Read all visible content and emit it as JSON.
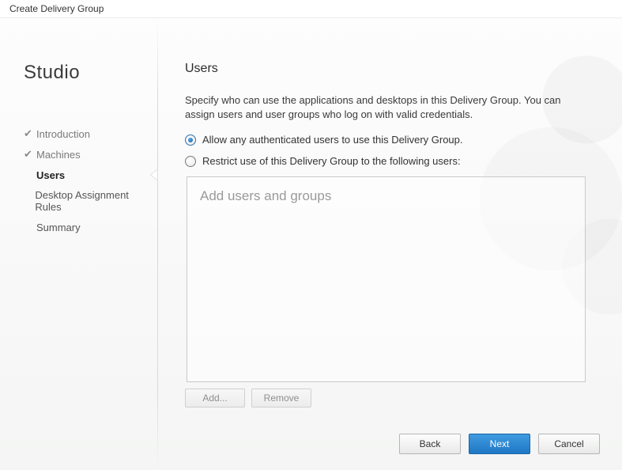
{
  "window": {
    "title": "Create Delivery Group"
  },
  "brand": "Studio",
  "sidebar": {
    "steps": [
      {
        "label": "Introduction",
        "state": "done"
      },
      {
        "label": "Machines",
        "state": "done"
      },
      {
        "label": "Users",
        "state": "current"
      },
      {
        "label": "Desktop Assignment Rules",
        "state": "pending"
      },
      {
        "label": "Summary",
        "state": "pending"
      }
    ]
  },
  "main": {
    "heading": "Users",
    "description": "Specify who can use the applications and desktops in this Delivery Group. You can assign users and user groups who log on with valid credentials.",
    "radios": {
      "allow_any": {
        "label": "Allow any authenticated users to use this Delivery Group.",
        "selected": true
      },
      "restrict": {
        "label": "Restrict use of this Delivery Group to the following users:",
        "selected": false
      }
    },
    "listbox": {
      "placeholder": "Add users and groups"
    },
    "buttons": {
      "add": "Add...",
      "remove": "Remove"
    }
  },
  "footer": {
    "back": "Back",
    "next": "Next",
    "cancel": "Cancel"
  }
}
